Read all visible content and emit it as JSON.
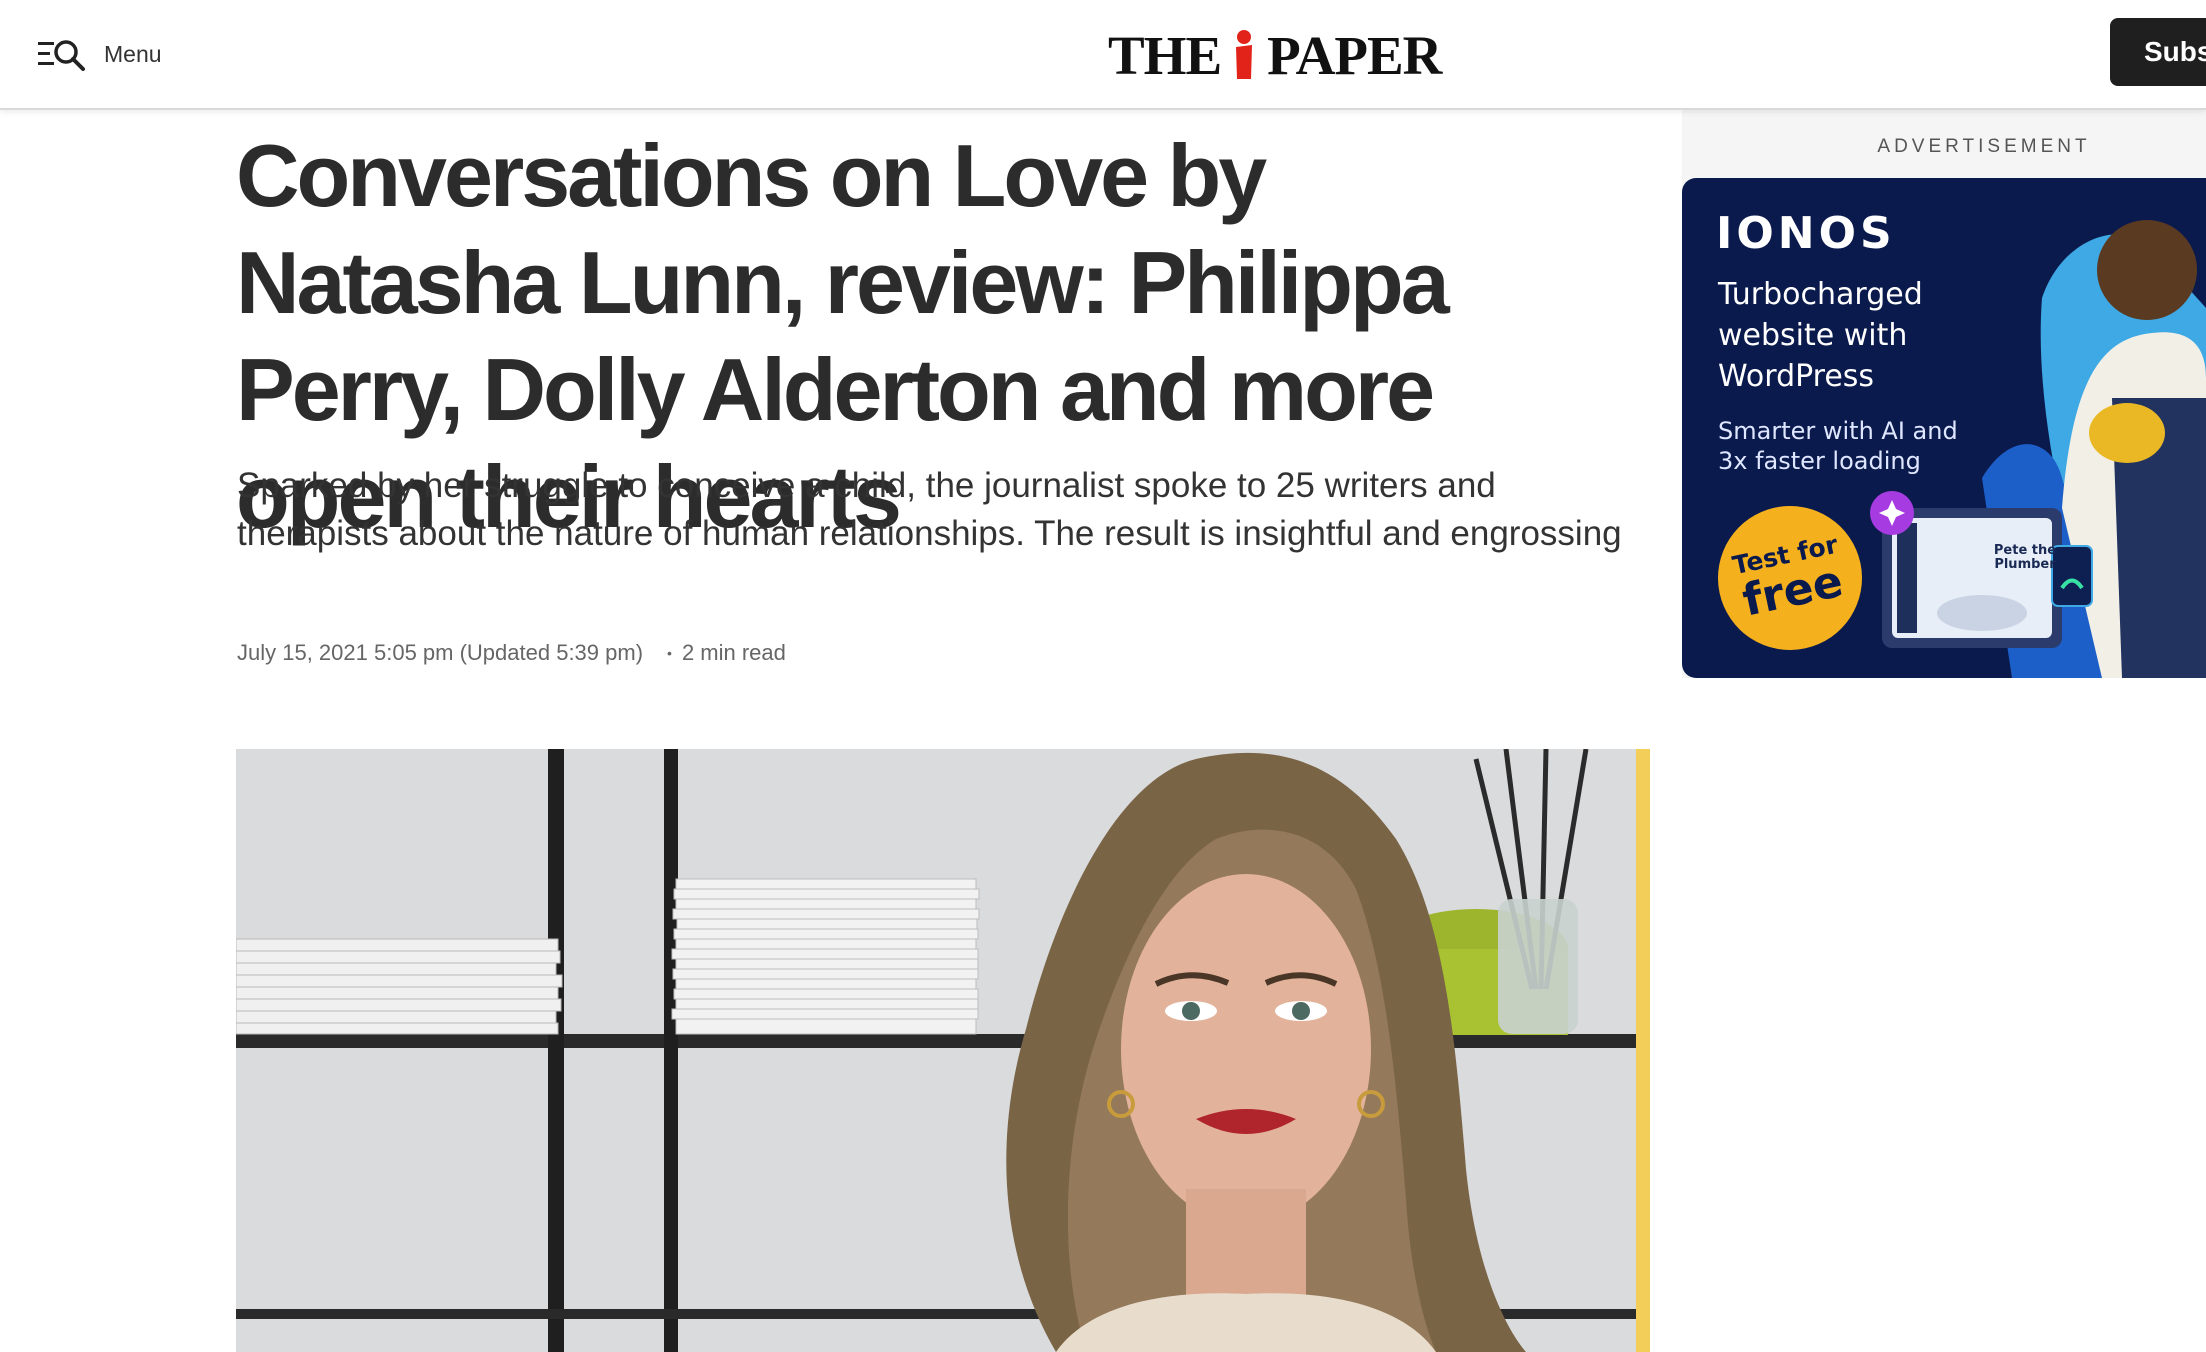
{
  "header": {
    "menu_label": "Menu",
    "logo_left": "THE",
    "logo_right": "PAPER",
    "subscribe_label": "Subs",
    "logo_accent_color": "#e2231a"
  },
  "article": {
    "headline": "Conversations on Love by Natasha Lunn, review: Philippa Perry, Dolly Alderton and more open their hearts",
    "standfirst": "Sparked by her struggle to conceive a child, the journalist spoke to 25 writers and therapists about the nature of human relationships. The result is insightful and engrossing",
    "date": "July 15, 2021 5:05 pm (Updated 5:39 pm)",
    "read_time": "2 min read"
  },
  "advertisement": {
    "label": "ADVERTISEMENT",
    "brand": "IONOS",
    "headline": "Turbocharged website with WordPress",
    "subline": "Smarter with AI and 3x faster loading",
    "badge_line1": "Test for",
    "badge_line2": "free",
    "tablet_text": "Pete the Plumber",
    "background_color": "#0b1a4d",
    "badge_color": "#f5b01e"
  }
}
